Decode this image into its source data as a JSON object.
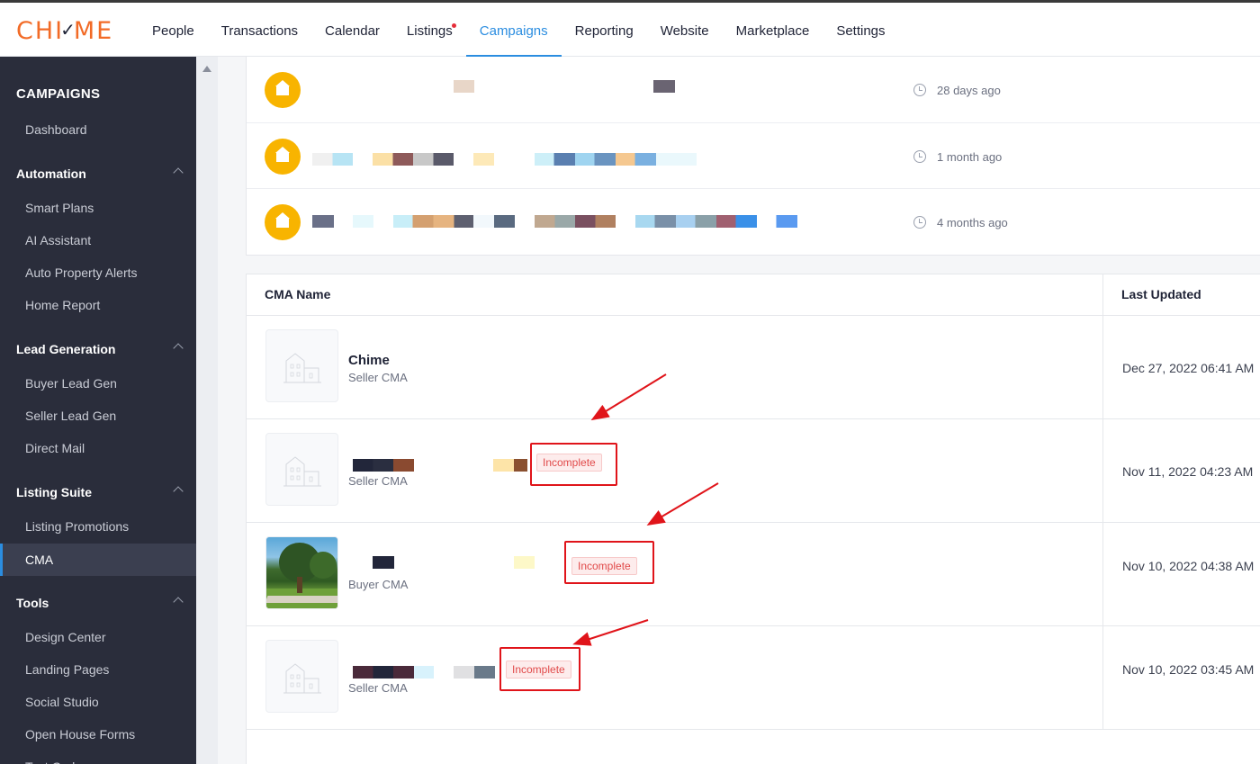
{
  "brand": {
    "logo_text": "CHI",
    "logo_check": "✓",
    "logo_rest": "ME",
    "accent": "#f26b27",
    "link": "#2b8de0"
  },
  "nav": {
    "items": [
      {
        "label": "People"
      },
      {
        "label": "Transactions"
      },
      {
        "label": "Calendar"
      },
      {
        "label": "Listings",
        "dot": true
      },
      {
        "label": "Campaigns",
        "active": true
      },
      {
        "label": "Reporting"
      },
      {
        "label": "Website"
      },
      {
        "label": "Marketplace"
      },
      {
        "label": "Settings"
      }
    ]
  },
  "sidebar": {
    "title": "CAMPAIGNS",
    "dashboard": "Dashboard",
    "automation": {
      "label": "Automation",
      "items": [
        "Smart Plans",
        "AI Assistant",
        "Auto Property Alerts",
        "Home Report"
      ]
    },
    "lead_generation": {
      "label": "Lead Generation",
      "items": [
        "Buyer Lead Gen",
        "Seller Lead Gen",
        "Direct Mail"
      ]
    },
    "listing_suite": {
      "label": "Listing Suite",
      "items": [
        "Listing Promotions",
        "CMA"
      ],
      "active": "CMA"
    },
    "tools": {
      "label": "Tools",
      "items": [
        "Design Center",
        "Landing Pages",
        "Social Studio",
        "Open House Forms",
        "Text Code"
      ]
    }
  },
  "activity": {
    "rows": [
      {
        "time": "28 days ago",
        "icon": "house-icon"
      },
      {
        "time": "1 month ago",
        "icon": "house-icon"
      },
      {
        "time": "4 months ago",
        "icon": "house-icon"
      }
    ]
  },
  "cma_table": {
    "headers": {
      "name": "CMA Name",
      "updated": "Last Updated"
    },
    "rows": [
      {
        "title": "Chime",
        "type": "Seller CMA",
        "date": "Dec 27, 2022 06:41 AM",
        "status": ""
      },
      {
        "title": "",
        "type": "Seller CMA",
        "date": "Nov 11, 2022 04:23 AM",
        "status": "Incomplete"
      },
      {
        "title": "",
        "type": "Buyer CMA",
        "date": "Nov 10, 2022 04:38 AM",
        "status": "Incomplete"
      },
      {
        "title": "",
        "type": "Seller CMA",
        "date": "Nov 10, 2022 03:45 AM",
        "status": "Incomplete"
      }
    ]
  }
}
